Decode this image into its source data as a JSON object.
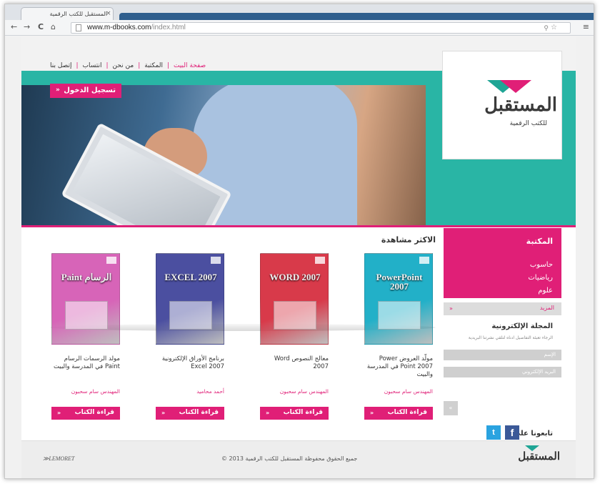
{
  "browser": {
    "tab_title": "المستقبل للكتب الرقمية",
    "tab_close": "×",
    "back": "←",
    "forward": "→",
    "reload": "C",
    "home": "⌂",
    "url_host": "www.m-dbooks.com",
    "url_path": "/index.html",
    "zoom_icon": "⚲",
    "star_icon": "☆",
    "menu_icon": "≡"
  },
  "nav": {
    "items": [
      "صفحة البيت",
      "المكتبة",
      "من نحن",
      "انتساب",
      "إتصل بنا"
    ],
    "separator": "|"
  },
  "header": {
    "login_label": "تسجيل الدخول",
    "arrow": "«",
    "logo_text": "المستقبل",
    "logo_sub": "للكتب الرقمية"
  },
  "sidebar": {
    "library_title": "المكتبة",
    "library_items": [
      "حاسوب",
      "رياضيات",
      "علوم"
    ],
    "more_label": "المزيد",
    "magazine_title": "المجلة الإلكترونية",
    "magazine_desc": "الرجاء تعبئة التفاصيل ادناه لتلقي نشرتنا البريدية",
    "name_placeholder": "الإسم",
    "email_placeholder": "البريد الإلكتروني",
    "submit_label": "«",
    "follow_label": "تابعونا على",
    "facebook": "f",
    "twitter": "t"
  },
  "main": {
    "section_title": "الاكثر مشاهدة",
    "read_label": "قراءة الكتاب",
    "books": [
      {
        "cover_title": "PowerPoint 2007",
        "title": "مولّد العروض Power Point 2007 في المدرسة والبيت",
        "author": "المهندس سام سحبون",
        "color": "#22b0c8"
      },
      {
        "cover_title": "WORD 2007",
        "title": "معالج النصوص Word 2007",
        "author": "المهندس سام سحبون",
        "color": "#d83a4a"
      },
      {
        "cover_title": "EXCEL 2007",
        "title": "برنامج الأوراق الإلكترونية Excel 2007",
        "author": "أحمد محاميد",
        "color": "#4b4fa0"
      },
      {
        "cover_title": "Paint الرسام",
        "title": "مولد الرسمات الرسام Paint في المدرسة والبيت",
        "author": "المهندس سام سحبون",
        "color": "#d764b8"
      }
    ]
  },
  "footer": {
    "logo_text": "المستقبل",
    "copyright": "جميع الحقوق محفوظة المستقبل للكتب الرقمية 2013 ©",
    "credit": "≫LEMORET"
  }
}
